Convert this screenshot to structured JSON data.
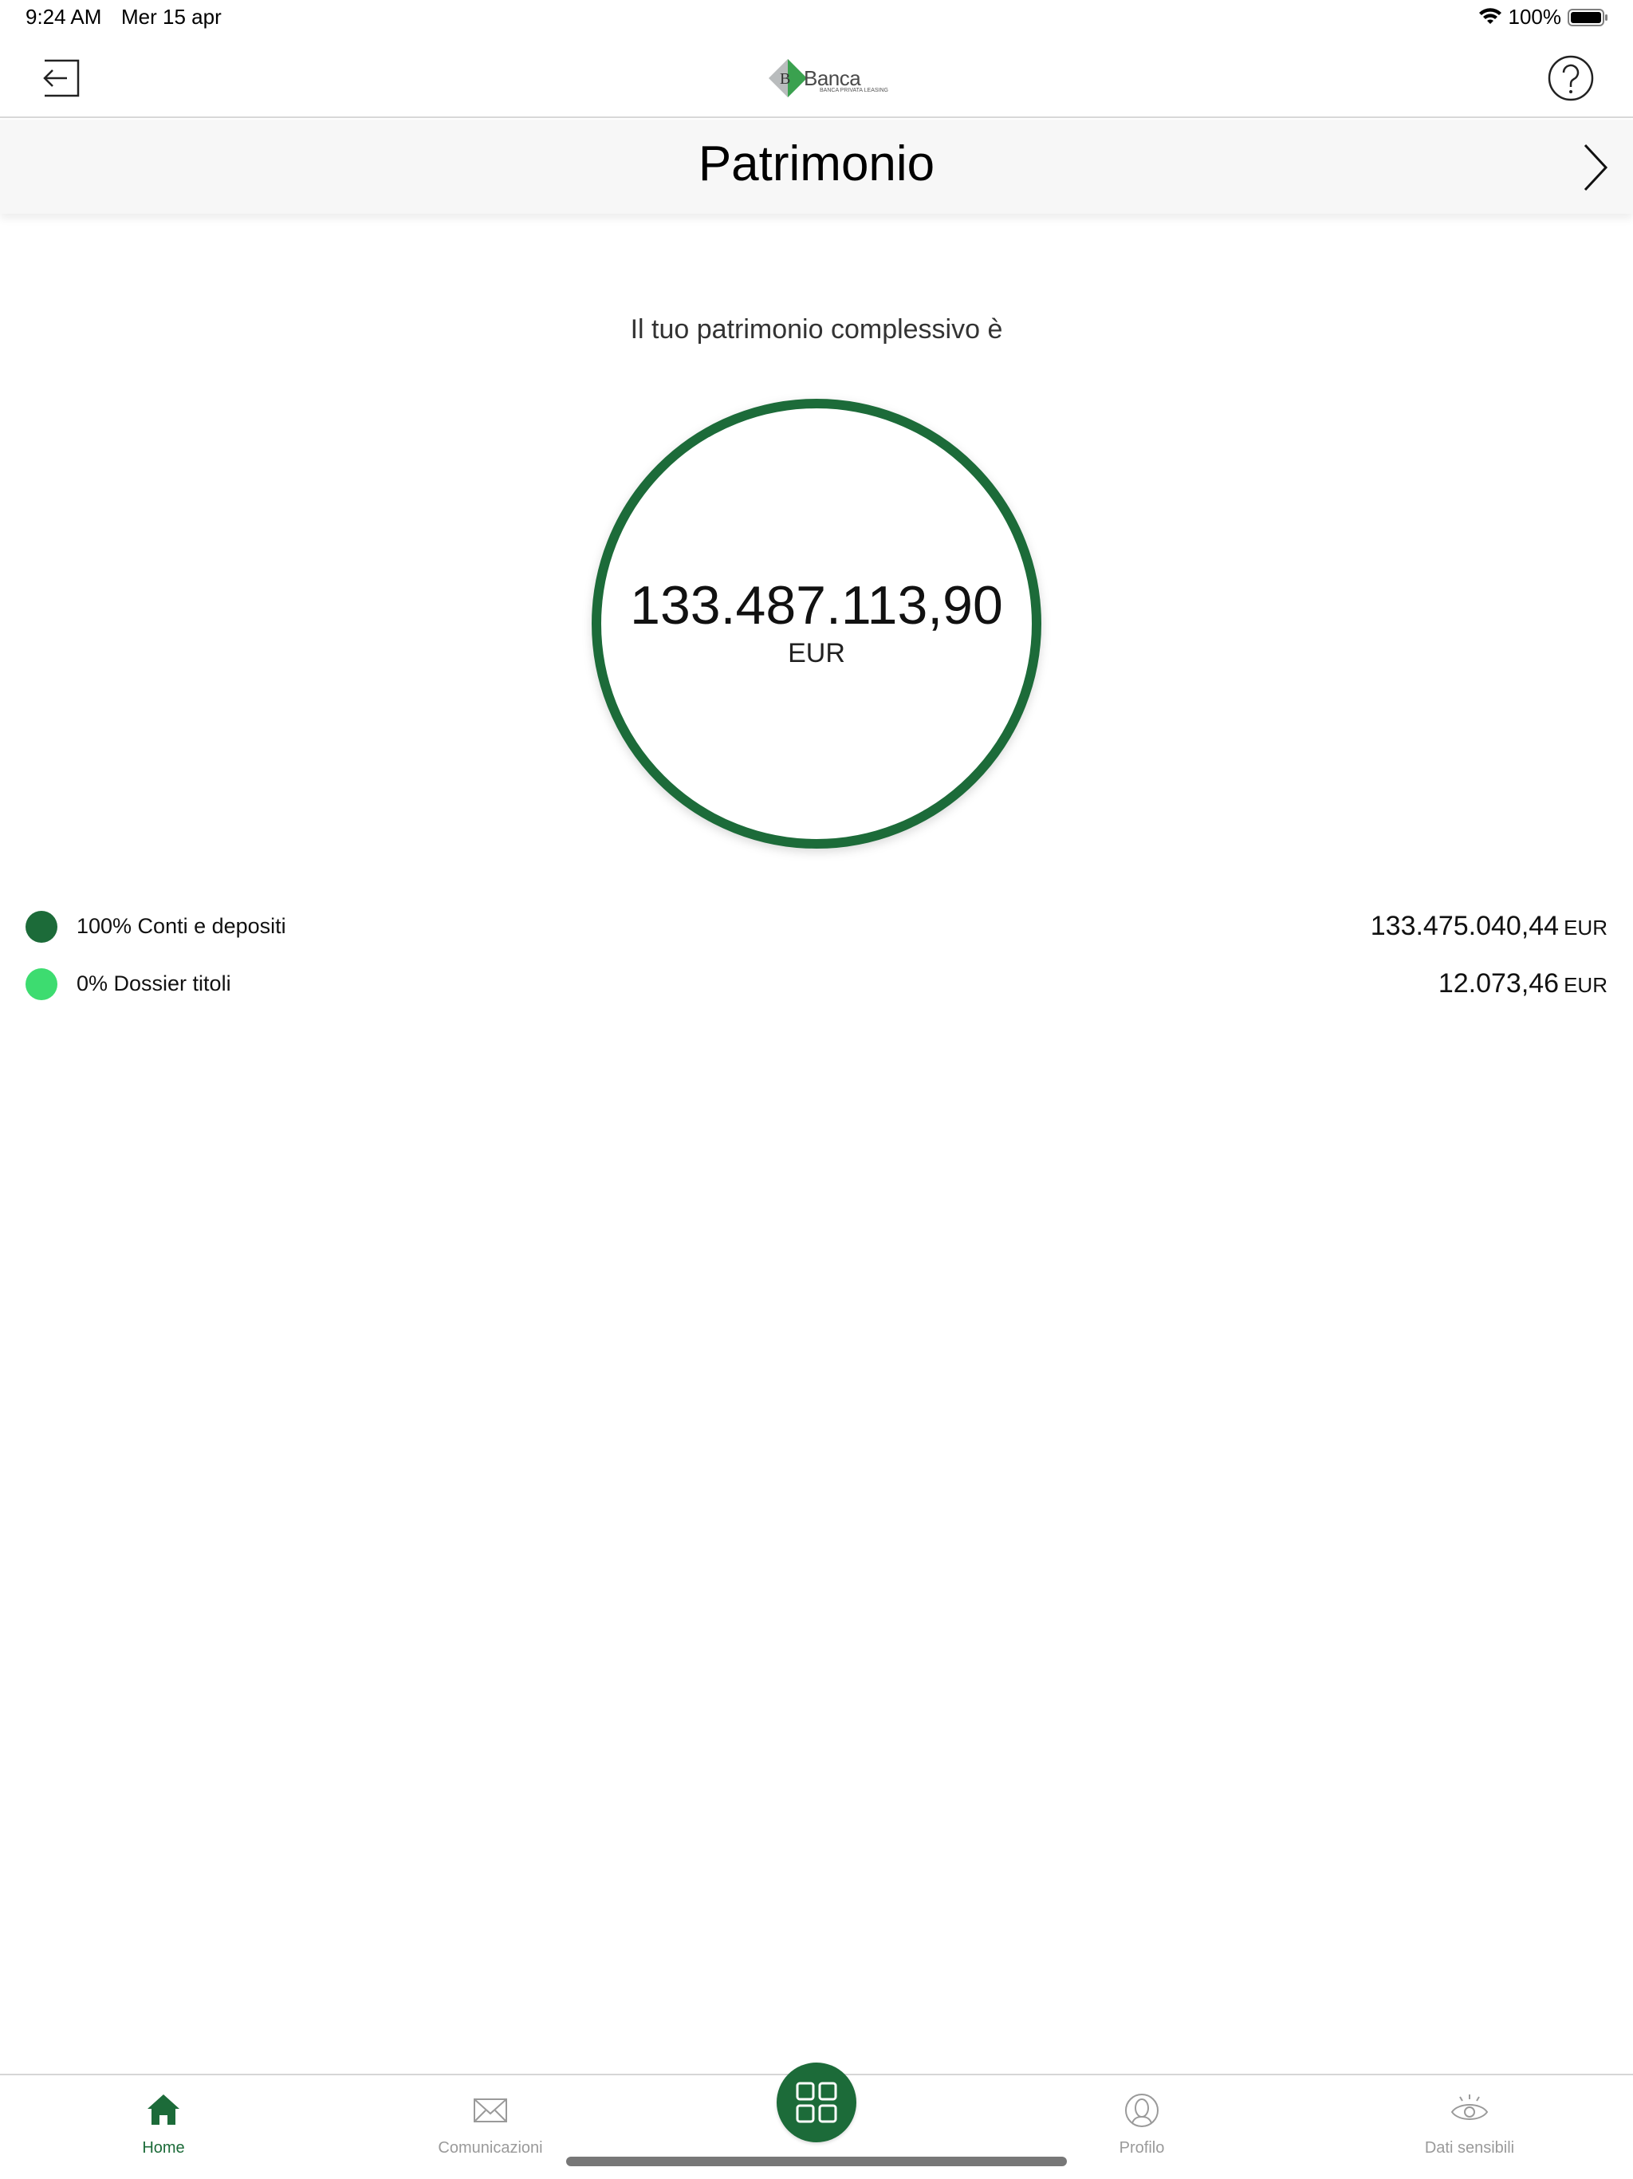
{
  "status_bar": {
    "time": "9:24 AM",
    "date": "Mer 15 apr",
    "battery": "100%"
  },
  "header": {
    "logo_text": "Banca",
    "logo_subtext": "BANCA PRIVATA LEASING",
    "back_icon": "logout-arrow-icon",
    "help_icon": "help-question-icon"
  },
  "title_bar": {
    "title": "Patrimonio",
    "next_icon": "chevron-right-icon"
  },
  "summary": {
    "label": "Il tuo patrimonio complessivo è",
    "total": "133.487.113,90",
    "currency": "EUR",
    "ring_color": "#1c6b39"
  },
  "breakdown": [
    {
      "label": "100% Conti e depositi",
      "value": "133.475.040,44",
      "currency": "EUR",
      "color": "#1c6b39",
      "percent": 100
    },
    {
      "label": "0% Dossier titoli",
      "value": "12.073,46",
      "currency": "EUR",
      "color": "#3ddc70",
      "percent": 0
    }
  ],
  "tabs": [
    {
      "label": "Home",
      "icon": "home-icon",
      "active": true
    },
    {
      "label": "Comunicazioni",
      "icon": "envelope-icon",
      "active": false
    },
    {
      "label": "Profilo",
      "icon": "profile-icon",
      "active": false
    },
    {
      "label": "Dati sensibili",
      "icon": "eye-icon",
      "active": false
    }
  ],
  "center_button": {
    "icon": "grid-icon"
  },
  "colors": {
    "accent": "#1c6b39",
    "secondary": "#3ddc70"
  }
}
